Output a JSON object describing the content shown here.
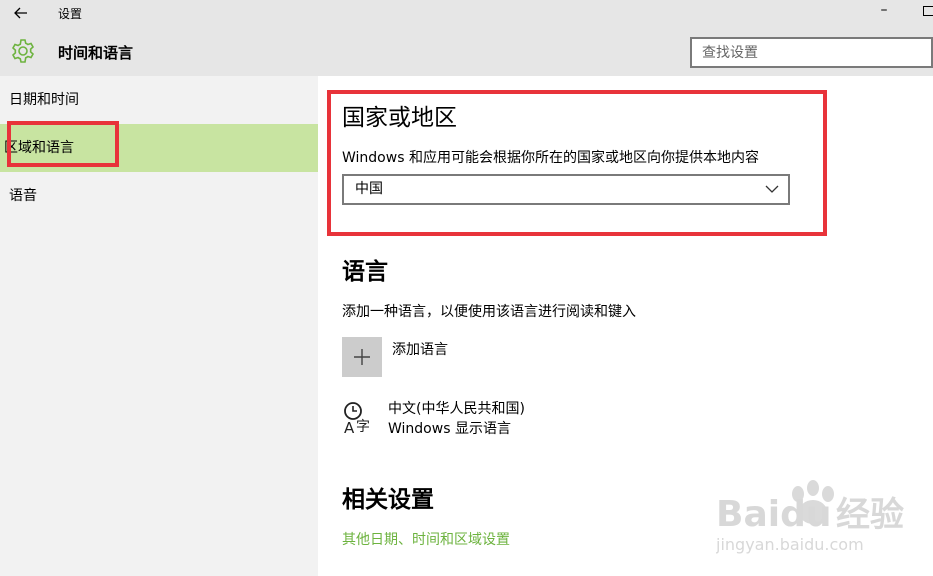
{
  "titlebar": {
    "back_icon": "arrow-left-icon",
    "title": "设置",
    "minimize_icon": "minimize-icon",
    "maximize_icon": "maximize-icon"
  },
  "header": {
    "icon": "gear-icon",
    "title": "时间和语言",
    "search": {
      "placeholder": "查找设置",
      "value": ""
    }
  },
  "sidebar": {
    "items": [
      {
        "label": "日期和时间",
        "selected": false
      },
      {
        "label": "区域和语言",
        "selected": true
      },
      {
        "label": "语音",
        "selected": false
      }
    ],
    "selected_color": "#c8e4a1"
  },
  "region": {
    "heading": "国家或地区",
    "description": "Windows 和应用可能会根据你所在的国家或地区向你提供本地内容",
    "selected_country": "中国"
  },
  "language": {
    "heading": "语言",
    "description": "添加一种语言，以便使用该语言进行阅读和键入",
    "add_label": "添加语言",
    "add_icon": "plus-icon",
    "entry": {
      "icon": "language-icon",
      "name": "中文(中华人民共和国)",
      "subtitle": "Windows 显示语言"
    }
  },
  "related": {
    "heading": "相关设置",
    "link": "其他日期、时间和区域设置",
    "link_color": "#6db33f"
  },
  "annotation_color": "#e8333a",
  "watermark": {
    "brand": "Baidu",
    "cn": "经验",
    "url": "jingyan.baidu.com"
  }
}
